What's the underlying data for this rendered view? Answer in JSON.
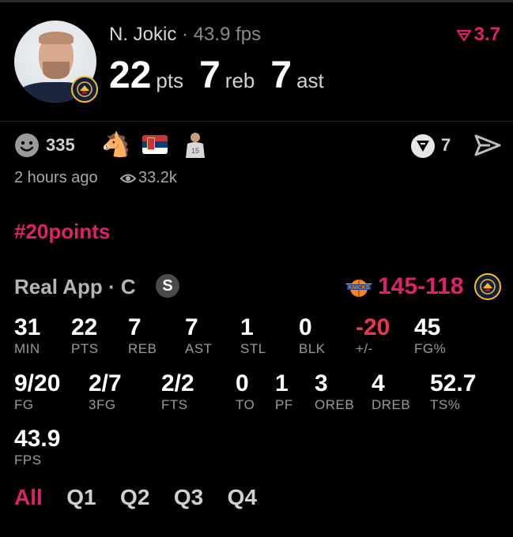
{
  "header": {
    "player_name": "N. Jokic",
    "separator": "·",
    "fps_text": "43.9 fps",
    "trend_value": "3.7",
    "stats": [
      {
        "value": "22",
        "unit": "pts"
      },
      {
        "value": "7",
        "unit": "reb"
      },
      {
        "value": "7",
        "unit": "ast"
      }
    ]
  },
  "social": {
    "reactions_count": "335",
    "votes_count": "7",
    "time_ago": "2 hours ago",
    "views": "33.2k",
    "hashtag": "#20points"
  },
  "game": {
    "source": "Real App · C",
    "badge": "S",
    "score_home": "145",
    "score_sep": "-",
    "score_away": "118"
  },
  "stats_rows": [
    [
      {
        "value": "31",
        "label": "MIN"
      },
      {
        "value": "22",
        "label": "PTS"
      },
      {
        "value": "7",
        "label": "REB"
      },
      {
        "value": "7",
        "label": "AST"
      },
      {
        "value": "1",
        "label": "STL"
      },
      {
        "value": "0",
        "label": "BLK"
      },
      {
        "value": "-20",
        "label": "+/-"
      },
      {
        "value": "45",
        "label": "FG%"
      }
    ],
    [
      {
        "value": "9/20",
        "label": "FG"
      },
      {
        "value": "2/7",
        "label": "3FG"
      },
      {
        "value": "2/2",
        "label": "FTS"
      },
      {
        "value": "0",
        "label": "TO"
      },
      {
        "value": "1",
        "label": "PF"
      },
      {
        "value": "3",
        "label": "OREB"
      },
      {
        "value": "4",
        "label": "DREB"
      },
      {
        "value": "52.7",
        "label": "TS%"
      }
    ],
    [
      {
        "value": "43.9",
        "label": "FPS"
      }
    ]
  ],
  "tabs": [
    "All",
    "Q1",
    "Q2",
    "Q3",
    "Q4"
  ],
  "colors": {
    "accent": "#e0206d",
    "negative": "#e8364a",
    "background": "#000000"
  }
}
